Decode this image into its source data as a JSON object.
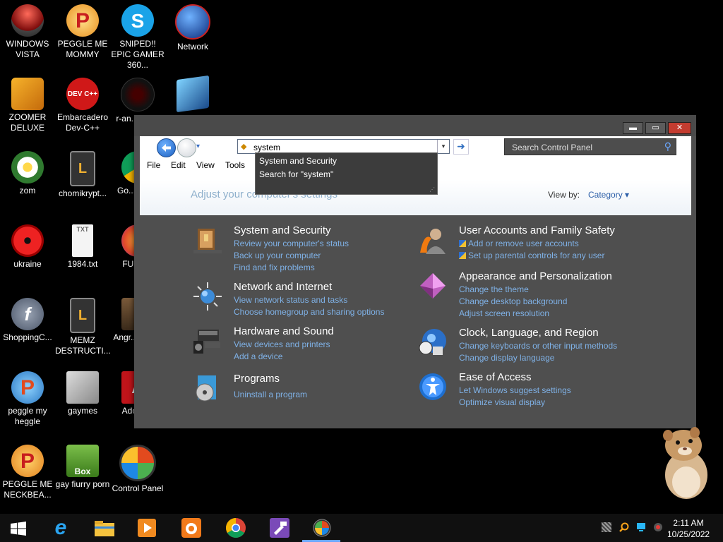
{
  "desktop": {
    "icons": [
      {
        "label": "WINDOWS VISTA"
      },
      {
        "label": "PEGGLE ME MOMMY"
      },
      {
        "label": "SNIPED!! EPIC GAMER 360..."
      },
      {
        "label": "Network"
      },
      {
        "label": "ZOOMER DELUXE"
      },
      {
        "label": "Embarcadero Dev-C++"
      },
      {
        "label": "r-an... par..."
      },
      {
        "label": "zom"
      },
      {
        "label": "chomikrypt..."
      },
      {
        "label": "Go... Chr..."
      },
      {
        "label": "ukraine"
      },
      {
        "label": "1984.txt"
      },
      {
        "label": "FURR..."
      },
      {
        "label": "ShoppingC..."
      },
      {
        "label": "MEMZ DESTRUCTI..."
      },
      {
        "label": "Angr... Sea..."
      },
      {
        "label": "peggle my heggle"
      },
      {
        "label": "gaymes"
      },
      {
        "label": "Adobe..."
      },
      {
        "label": "PEGGLE ME NECKBEA..."
      },
      {
        "label": "gay fiurry porn"
      },
      {
        "label": "Control Panel"
      }
    ],
    "icon_glyphs": {
      "dev": "DEV C++",
      "box": "Box",
      "flash": "f",
      "p": "P",
      "txt": "TXT"
    }
  },
  "window": {
    "controls": {
      "minimize": "▬",
      "maximize": "▭",
      "close": "✕"
    },
    "nav": {
      "dropdown_glyph": "▾"
    },
    "address": {
      "value": "system",
      "dropdown_glyph": "▾",
      "go_glyph": "➜"
    },
    "search": {
      "placeholder": "Search Control Panel"
    },
    "menu": [
      "File",
      "Edit",
      "View",
      "Tools"
    ],
    "autocomplete": [
      "System and Security",
      "Search for \"system\""
    ],
    "heading": "Adjust your computer's settings",
    "view_by": {
      "label": "View by:",
      "value": "Category ▾"
    },
    "categories": [
      {
        "title": "System and Security",
        "links": [
          "Review your computer's status",
          "Back up your computer",
          "Find and fix problems"
        ]
      },
      {
        "title": "User Accounts and Family Safety",
        "links": [
          "Add or remove user accounts",
          "Set up parental controls for any user"
        ]
      },
      {
        "title": "Network and Internet",
        "links": [
          "View network status and tasks",
          "Choose homegroup and sharing options"
        ]
      },
      {
        "title": "Appearance and Personalization",
        "links": [
          "Change the theme",
          "Change desktop background",
          "Adjust screen resolution"
        ]
      },
      {
        "title": "Hardware and Sound",
        "links": [
          "View devices and printers",
          "Add a device"
        ]
      },
      {
        "title": "Clock, Language, and Region",
        "links": [
          "Change keyboards or other input methods",
          "Change display language"
        ]
      },
      {
        "title": "Programs",
        "links": [
          "Uninstall a program"
        ]
      },
      {
        "title": "Ease of Access",
        "links": [
          "Let Windows suggest settings",
          "Optimize visual display"
        ]
      }
    ]
  },
  "taskbar": {
    "clock": {
      "time": "2:11 AM",
      "date": "10/25/2022"
    },
    "ie_glyph": "e"
  },
  "colors": {
    "link": "#7fb1e6",
    "window_bg": "#4f4f4f",
    "close_red": "#c43c30",
    "accent_blue": "#2d5fa8"
  }
}
